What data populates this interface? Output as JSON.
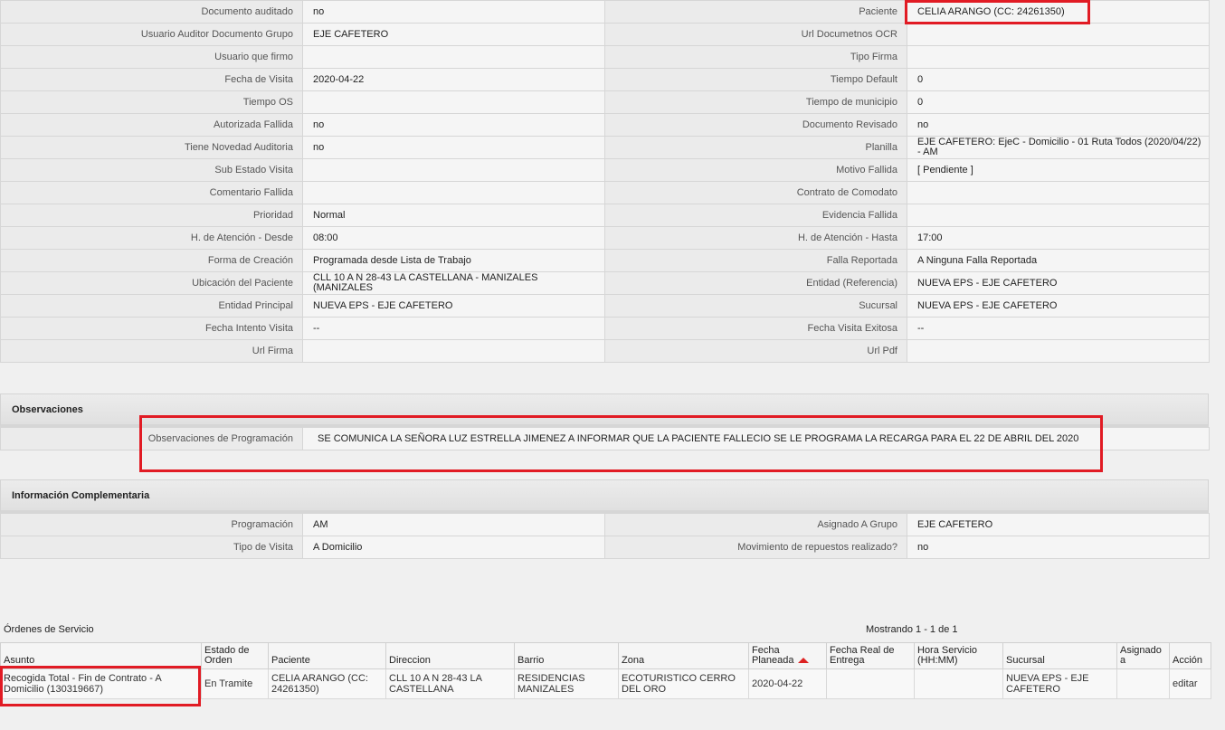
{
  "details": {
    "rows": [
      {
        "l1": "Documento auditado",
        "v1": "no",
        "l2": "Paciente",
        "v2": "CELIA ARANGO (CC: 24261350)"
      },
      {
        "l1": "Usuario Auditor Documento Grupo",
        "v1": "EJE CAFETERO",
        "l2": "Url Documetnos OCR",
        "v2": ""
      },
      {
        "l1": "Usuario que firmo",
        "v1": "",
        "l2": "Tipo Firma",
        "v2": ""
      },
      {
        "l1": "Fecha de Visita",
        "v1": "2020-04-22",
        "l2": "Tiempo Default",
        "v2": "0"
      },
      {
        "l1": "Tiempo OS",
        "v1": "",
        "l2": "Tiempo de municipio",
        "v2": "0"
      },
      {
        "l1": "Autorizada Fallida",
        "v1": "no",
        "l2": "Documento Revisado",
        "v2": "no"
      },
      {
        "l1": "Tiene Novedad Auditoria",
        "v1": "no",
        "l2": "Planilla",
        "v2": "EJE CAFETERO: EjeC - Domicilio - 01 Ruta Todos (2020/04/22) - AM"
      },
      {
        "l1": "Sub Estado Visita",
        "v1": "",
        "l2": "Motivo Fallida",
        "v2": "[ Pendiente ]"
      },
      {
        "l1": "Comentario Fallida",
        "v1": "",
        "l2": "Contrato de Comodato",
        "v2": ""
      },
      {
        "l1": "Prioridad",
        "v1": "Normal",
        "l2": "Evidencia Fallida",
        "v2": ""
      },
      {
        "l1": "H. de Atención - Desde",
        "v1": "08:00",
        "l2": "H. de Atención - Hasta",
        "v2": "17:00"
      },
      {
        "l1": "Forma de Creación",
        "v1": "Programada desde Lista de Trabajo",
        "l2": "Falla Reportada",
        "v2": "A Ninguna Falla Reportada"
      },
      {
        "l1": "Ubicación del Paciente",
        "v1": "CLL 10 A N 28-43 LA CASTELLANA - MANIZALES (MANIZALES",
        "l2": "Entidad (Referencia)",
        "v2": "NUEVA EPS - EJE CAFETERO"
      },
      {
        "l1": "Entidad Principal",
        "v1": "NUEVA EPS - EJE CAFETERO",
        "l2": "Sucursal",
        "v2": "NUEVA EPS - EJE CAFETERO"
      },
      {
        "l1": "Fecha Intento Visita",
        "v1": "--",
        "l2": "Fecha Visita Exitosa",
        "v2": "--"
      },
      {
        "l1": "Url Firma",
        "v1": "",
        "l2": "Url Pdf",
        "v2": ""
      }
    ]
  },
  "observaciones": {
    "title": "Observaciones",
    "label": "Observaciones de Programación",
    "value": "SE COMUNICA LA SEÑORA LUZ ESTRELLA JIMENEZ A INFORMAR QUE LA PACIENTE FALLECIO SE LE PROGRAMA LA RECARGA PARA EL 22 DE ABRIL DEL 2020"
  },
  "complementaria": {
    "title": "Información Complementaria",
    "rows": [
      {
        "l1": "Programación",
        "v1": "AM",
        "l2": "Asignado A Grupo",
        "v2": "EJE CAFETERO"
      },
      {
        "l1": "Tipo de Visita",
        "v1": "A Domicilio",
        "l2": "Movimiento de repuestos realizado?",
        "v2": "no"
      }
    ]
  },
  "orders": {
    "title": "Órdenes de Servicio",
    "count_text": "Mostrando 1 - 1 de 1",
    "headers": [
      "Asunto",
      "Estado de Orden",
      "Paciente",
      "Direccion",
      "Barrio",
      "Zona",
      "Fecha Planeada",
      "Fecha Real de Entrega",
      "Hora Servicio (HH:MM)",
      "Sucursal",
      "Asignado a",
      "Acción"
    ],
    "rows": [
      {
        "asunto": "Recogida Total - Fin de Contrato - A Domicilio (130319667)",
        "estado": "En Tramite",
        "paciente": "CELIA ARANGO (CC: 24261350)",
        "direccion": "CLL 10 A N 28-43 LA CASTELLANA",
        "barrio": "RESIDENCIAS MANIZALES",
        "zona": "ECOTURISTICO CERRO DEL ORO",
        "fecha_planeada": "2020-04-22",
        "fecha_real": "",
        "hora": "",
        "sucursal": "NUEVA EPS - EJE CAFETERO",
        "asignado": "",
        "accion": "editar"
      }
    ]
  },
  "colors": {
    "highlight": "#e11b24",
    "sort_arrow": "#d22"
  }
}
